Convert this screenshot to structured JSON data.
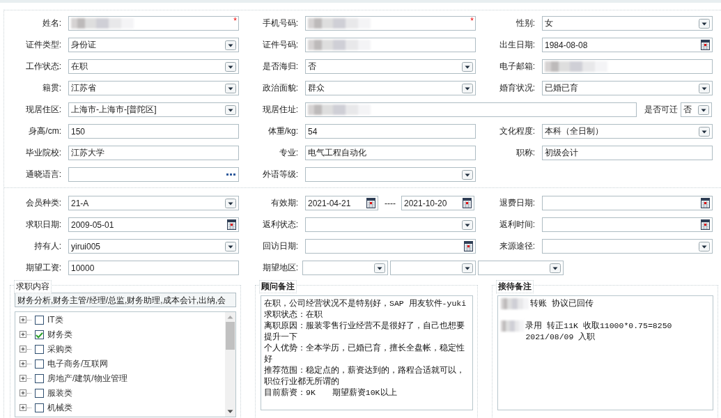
{
  "basic_info": {
    "rows": [
      [
        {
          "label": "姓名:",
          "kind": "text",
          "redacted": true,
          "required_mark": "*"
        },
        {
          "label": "手机号码:",
          "kind": "text",
          "redacted": true,
          "required_mark": "*"
        },
        {
          "label": "性别:",
          "kind": "select",
          "value": "女"
        }
      ],
      [
        {
          "label": "证件类型:",
          "kind": "select",
          "value": "身份证"
        },
        {
          "label": "证件号码:",
          "kind": "text",
          "redacted": true
        },
        {
          "label": "出生日期:",
          "kind": "date",
          "value": "1984-08-08"
        }
      ],
      [
        {
          "label": "工作状态:",
          "kind": "select",
          "value": "在职"
        },
        {
          "label": "是否海归:",
          "kind": "select",
          "value": "否"
        },
        {
          "label": "电子邮箱:",
          "kind": "text",
          "redacted": true
        }
      ],
      [
        {
          "label": "籍贯:",
          "kind": "select",
          "value": "江苏省"
        },
        {
          "label": "政治面貌:",
          "kind": "select",
          "value": "群众"
        },
        {
          "label": "婚育状况:",
          "kind": "select",
          "value": "已婚已育"
        }
      ],
      [
        {
          "label": "现居住区:",
          "kind": "select",
          "value": " 上海市-上海市-[普陀区]"
        },
        {
          "label": "现居住址:",
          "kind": "wide_text",
          "redacted": true
        },
        {
          "label": "是否可迁",
          "kind": "mini_select",
          "value": "否"
        }
      ],
      [
        {
          "label": "身高/cm:",
          "kind": "text",
          "value": "150"
        },
        {
          "label": "体重/kg:",
          "kind": "text",
          "value": "54"
        },
        {
          "label": "文化程度:",
          "kind": "select",
          "value": "本科（全日制）"
        }
      ],
      [
        {
          "label": "毕业院校:",
          "kind": "text",
          "value": "江苏大学"
        },
        {
          "label": "专业:",
          "kind": "text",
          "value": "电气工程自动化"
        },
        {
          "label": "职称:",
          "kind": "text",
          "value": "初级会计"
        }
      ],
      [
        {
          "label": "通晓语言:",
          "kind": "lookup"
        },
        {
          "label": "外语等级:",
          "kind": "select"
        }
      ]
    ]
  },
  "membership": {
    "rows": [
      [
        {
          "label": "会员种类:",
          "kind": "select",
          "value": " 21-A"
        },
        {
          "label": "有效期:",
          "kind": "date_range",
          "from": "2021-04-21",
          "separator": "----",
          "to": "2021-10-20"
        },
        {
          "label": "退费日期:",
          "kind": "date"
        }
      ],
      [
        {
          "label": "求职日期:",
          "kind": "date",
          "value": "2009-05-01"
        },
        {
          "label": "返利状态:",
          "kind": "select"
        },
        {
          "label": "返利时间:",
          "kind": "date"
        }
      ],
      [
        {
          "label": "持有人:",
          "kind": "select",
          "value": "yirui005"
        },
        {
          "label": "回访日期:",
          "kind": "date"
        },
        {
          "label": "来源途径:",
          "kind": "select"
        }
      ],
      [
        {
          "label": "期望工资:",
          "kind": "text",
          "value": "10000"
        },
        {
          "label": "期望地区:",
          "kind": "select_group",
          "selects": [
            {
              "kind": "select"
            },
            {
              "kind": "select"
            },
            {
              "kind": "select"
            }
          ]
        }
      ]
    ]
  },
  "job_intent": {
    "title": "求职内容",
    "selected_text": "财务分析,财务主管/经理/总监,财务助理,成本会计,出纳,会",
    "tree": [
      {
        "label": "IT类",
        "expanded": false,
        "checked": false
      },
      {
        "label": "财务类",
        "expanded": false,
        "checked": true
      },
      {
        "label": "采购类",
        "expanded": false,
        "checked": false
      },
      {
        "label": "电子商务/互联网",
        "expanded": false,
        "checked": false
      },
      {
        "label": "房地产/建筑/物业管理",
        "expanded": false,
        "checked": false
      },
      {
        "label": "服装类",
        "expanded": false,
        "checked": false
      },
      {
        "label": "机械类",
        "expanded": false,
        "checked": false
      }
    ]
  },
  "consultant_notes": {
    "title": "顾问备注",
    "lines": [
      {
        "text": "在职，公司经营状况不是特别好，SAP 用友软件-yuki"
      },
      {
        "text": "求职状态：在职"
      },
      {
        "text": "离职原因：服装零售行业经营不是很好了，自己也想要提升一下"
      },
      {
        "text": "个人优势：全本学历，已婚已育，擅长全盘帐，稳定性好"
      },
      {
        "text": "推荐范围：稳定点的，薪资达到的，路程合适就可以，职位行业都无所谓的"
      },
      {
        "text": "目前薪资：9K　　期望薪资10K以上"
      }
    ]
  },
  "reception_notes": {
    "title": "接待备注",
    "lines": [
      {
        "redacted": true,
        "text": " 转账 协议已回传"
      },
      {
        "redacted": true,
        "text": "录用 转正11K  收取11000*0.75=8250 2021/08/09 入职"
      }
    ]
  }
}
